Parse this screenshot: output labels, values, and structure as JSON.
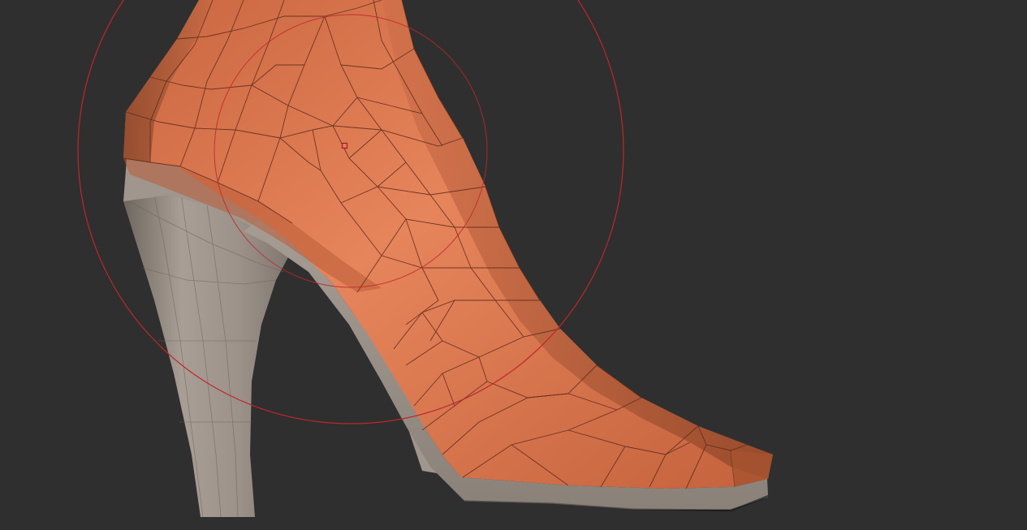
{
  "viewport": {
    "background_color": "#2f2f2f"
  },
  "model": {
    "name": "high-heel-shoe-mesh",
    "skin_color": "#d9734b",
    "skin_light_color": "#e98a62",
    "skin_dark_color": "#9a4e2f",
    "sole_color": "#a49a91",
    "sole_dark_color": "#7e756d",
    "wire_color": "#5a2a1a"
  },
  "brush": {
    "ring_color": "#c0262b",
    "cursor_icon": "square-dot-icon"
  }
}
